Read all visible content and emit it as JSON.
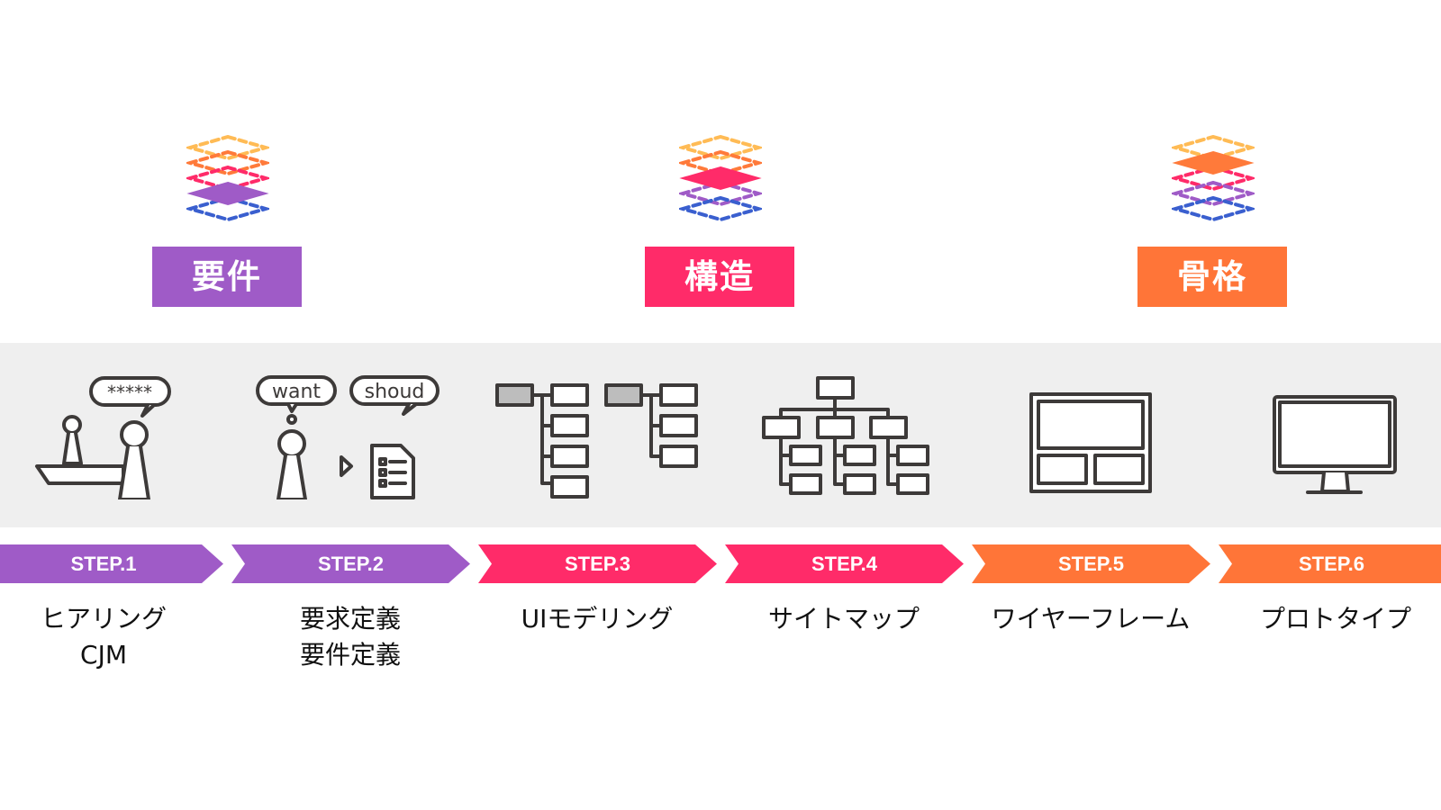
{
  "colors": {
    "requirements": "#9f5bc7",
    "structure": "#ff2b69",
    "skeleton": "#ff7538",
    "layer_yellow": "#ffbb55",
    "layer_orange": "#ff7a3a",
    "layer_pink": "#ff2b69",
    "layer_purple": "#9f5bc7",
    "layer_blue": "#3a5fcf",
    "icon_stroke": "#3d3a39",
    "band_bg": "#efefef"
  },
  "phases": [
    {
      "label": "要件",
      "active_layer": "purple",
      "color": "#9f5bc7"
    },
    {
      "label": "構造",
      "active_layer": "pink",
      "color": "#ff2b69"
    },
    {
      "label": "骨格",
      "active_layer": "orange",
      "color": "#ff7538"
    }
  ],
  "icons": {
    "hearing_bubble": "*****",
    "want_bubble": "want",
    "should_bubble": "shoud"
  },
  "steps": [
    {
      "label": "STEP.1",
      "caption": [
        "ヒアリング",
        "CJM"
      ],
      "color": "#9f5bc7"
    },
    {
      "label": "STEP.2",
      "caption": [
        "要求定義",
        "要件定義"
      ],
      "color": "#9f5bc7"
    },
    {
      "label": "STEP.3",
      "caption": [
        "UIモデリング"
      ],
      "color": "#ff2b69"
    },
    {
      "label": "STEP.4",
      "caption": [
        "サイトマップ"
      ],
      "color": "#ff2b69"
    },
    {
      "label": "STEP.5",
      "caption": [
        "ワイヤーフレーム"
      ],
      "color": "#ff7538"
    },
    {
      "label": "STEP.6",
      "caption": [
        "プロトタイプ"
      ],
      "color": "#ff7538"
    }
  ]
}
